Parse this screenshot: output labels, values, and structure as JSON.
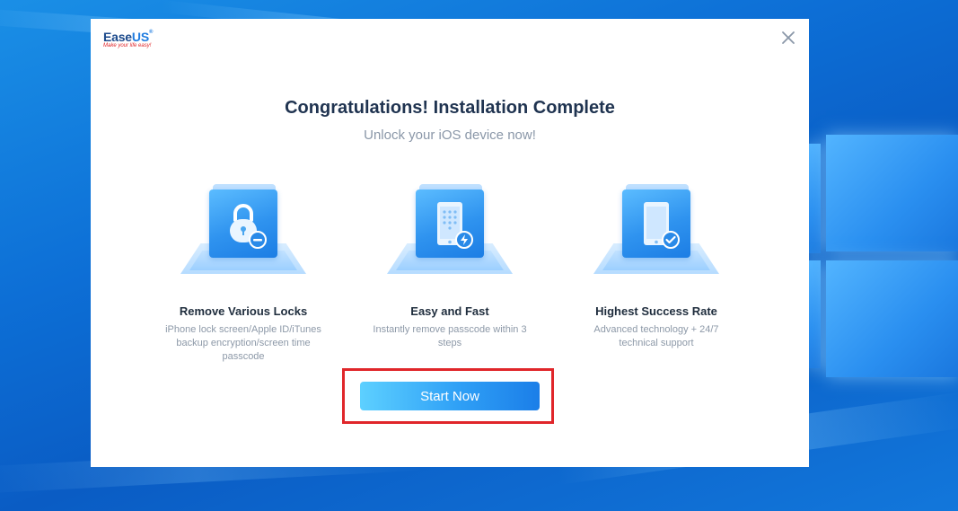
{
  "logo": {
    "brand_dark": "Ease",
    "brand_accent": "US",
    "registered": "®",
    "tagline": "Make your life easy!"
  },
  "dialog": {
    "title": "Congratulations! Installation Complete",
    "subtitle": "Unlock your iOS device now!",
    "close_icon": "close-icon",
    "start_button_label": "Start Now"
  },
  "features": [
    {
      "icon": "lock-minus-icon",
      "title": "Remove Various Locks",
      "description": "iPhone lock screen/Apple ID/iTunes backup encryption/screen time passcode"
    },
    {
      "icon": "phone-keypad-bolt-icon",
      "title": "Easy and Fast",
      "description": "Instantly remove passcode within 3 steps"
    },
    {
      "icon": "phone-check-icon",
      "title": "Highest Success Rate",
      "description": "Advanced technology + 24/7 technical support"
    }
  ],
  "colors": {
    "accent": "#2f93ef",
    "highlight_border": "#e0262a",
    "title": "#1f3350",
    "muted": "#8a97a8"
  }
}
